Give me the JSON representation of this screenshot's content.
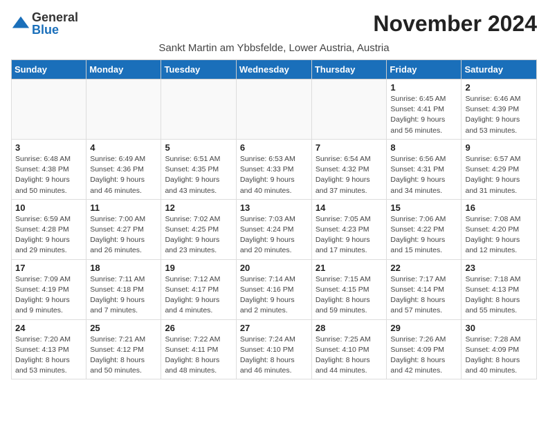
{
  "logo": {
    "general": "General",
    "blue": "Blue"
  },
  "header": {
    "month_year": "November 2024",
    "location": "Sankt Martin am Ybbsfelde, Lower Austria, Austria"
  },
  "days_of_week": [
    "Sunday",
    "Monday",
    "Tuesday",
    "Wednesday",
    "Thursday",
    "Friday",
    "Saturday"
  ],
  "weeks": [
    [
      {
        "day": "",
        "info": ""
      },
      {
        "day": "",
        "info": ""
      },
      {
        "day": "",
        "info": ""
      },
      {
        "day": "",
        "info": ""
      },
      {
        "day": "",
        "info": ""
      },
      {
        "day": "1",
        "info": "Sunrise: 6:45 AM\nSunset: 4:41 PM\nDaylight: 9 hours and 56 minutes."
      },
      {
        "day": "2",
        "info": "Sunrise: 6:46 AM\nSunset: 4:39 PM\nDaylight: 9 hours and 53 minutes."
      }
    ],
    [
      {
        "day": "3",
        "info": "Sunrise: 6:48 AM\nSunset: 4:38 PM\nDaylight: 9 hours and 50 minutes."
      },
      {
        "day": "4",
        "info": "Sunrise: 6:49 AM\nSunset: 4:36 PM\nDaylight: 9 hours and 46 minutes."
      },
      {
        "day": "5",
        "info": "Sunrise: 6:51 AM\nSunset: 4:35 PM\nDaylight: 9 hours and 43 minutes."
      },
      {
        "day": "6",
        "info": "Sunrise: 6:53 AM\nSunset: 4:33 PM\nDaylight: 9 hours and 40 minutes."
      },
      {
        "day": "7",
        "info": "Sunrise: 6:54 AM\nSunset: 4:32 PM\nDaylight: 9 hours and 37 minutes."
      },
      {
        "day": "8",
        "info": "Sunrise: 6:56 AM\nSunset: 4:31 PM\nDaylight: 9 hours and 34 minutes."
      },
      {
        "day": "9",
        "info": "Sunrise: 6:57 AM\nSunset: 4:29 PM\nDaylight: 9 hours and 31 minutes."
      }
    ],
    [
      {
        "day": "10",
        "info": "Sunrise: 6:59 AM\nSunset: 4:28 PM\nDaylight: 9 hours and 29 minutes."
      },
      {
        "day": "11",
        "info": "Sunrise: 7:00 AM\nSunset: 4:27 PM\nDaylight: 9 hours and 26 minutes."
      },
      {
        "day": "12",
        "info": "Sunrise: 7:02 AM\nSunset: 4:25 PM\nDaylight: 9 hours and 23 minutes."
      },
      {
        "day": "13",
        "info": "Sunrise: 7:03 AM\nSunset: 4:24 PM\nDaylight: 9 hours and 20 minutes."
      },
      {
        "day": "14",
        "info": "Sunrise: 7:05 AM\nSunset: 4:23 PM\nDaylight: 9 hours and 17 minutes."
      },
      {
        "day": "15",
        "info": "Sunrise: 7:06 AM\nSunset: 4:22 PM\nDaylight: 9 hours and 15 minutes."
      },
      {
        "day": "16",
        "info": "Sunrise: 7:08 AM\nSunset: 4:20 PM\nDaylight: 9 hours and 12 minutes."
      }
    ],
    [
      {
        "day": "17",
        "info": "Sunrise: 7:09 AM\nSunset: 4:19 PM\nDaylight: 9 hours and 9 minutes."
      },
      {
        "day": "18",
        "info": "Sunrise: 7:11 AM\nSunset: 4:18 PM\nDaylight: 9 hours and 7 minutes."
      },
      {
        "day": "19",
        "info": "Sunrise: 7:12 AM\nSunset: 4:17 PM\nDaylight: 9 hours and 4 minutes."
      },
      {
        "day": "20",
        "info": "Sunrise: 7:14 AM\nSunset: 4:16 PM\nDaylight: 9 hours and 2 minutes."
      },
      {
        "day": "21",
        "info": "Sunrise: 7:15 AM\nSunset: 4:15 PM\nDaylight: 8 hours and 59 minutes."
      },
      {
        "day": "22",
        "info": "Sunrise: 7:17 AM\nSunset: 4:14 PM\nDaylight: 8 hours and 57 minutes."
      },
      {
        "day": "23",
        "info": "Sunrise: 7:18 AM\nSunset: 4:13 PM\nDaylight: 8 hours and 55 minutes."
      }
    ],
    [
      {
        "day": "24",
        "info": "Sunrise: 7:20 AM\nSunset: 4:13 PM\nDaylight: 8 hours and 53 minutes."
      },
      {
        "day": "25",
        "info": "Sunrise: 7:21 AM\nSunset: 4:12 PM\nDaylight: 8 hours and 50 minutes."
      },
      {
        "day": "26",
        "info": "Sunrise: 7:22 AM\nSunset: 4:11 PM\nDaylight: 8 hours and 48 minutes."
      },
      {
        "day": "27",
        "info": "Sunrise: 7:24 AM\nSunset: 4:10 PM\nDaylight: 8 hours and 46 minutes."
      },
      {
        "day": "28",
        "info": "Sunrise: 7:25 AM\nSunset: 4:10 PM\nDaylight: 8 hours and 44 minutes."
      },
      {
        "day": "29",
        "info": "Sunrise: 7:26 AM\nSunset: 4:09 PM\nDaylight: 8 hours and 42 minutes."
      },
      {
        "day": "30",
        "info": "Sunrise: 7:28 AM\nSunset: 4:09 PM\nDaylight: 8 hours and 40 minutes."
      }
    ]
  ]
}
